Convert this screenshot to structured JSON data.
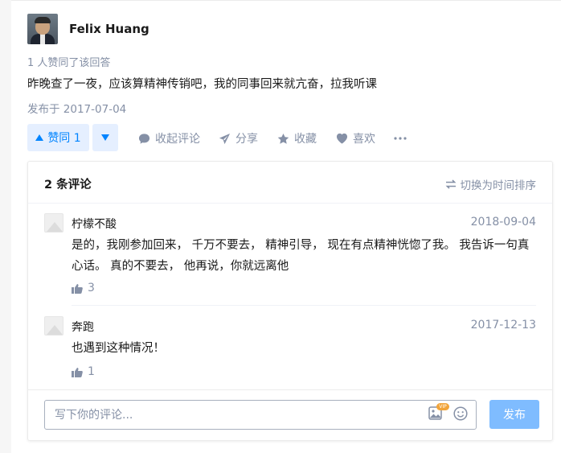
{
  "answer": {
    "author": "Felix Huang",
    "votes_text": "1 人赞同了该回答",
    "content": "昨晚查了一夜，应该算精神传销吧，我的同事回来就亢奋，拉我听课",
    "published": "发布于 2017-07-04"
  },
  "actions": {
    "upvote_label": "赞同 1",
    "collapse_comments": "收起评论",
    "share": "分享",
    "favorite": "收藏",
    "like": "喜欢"
  },
  "comments_panel": {
    "count_label": "2 条评论",
    "switch_sort": "切换为时间排序",
    "items": [
      {
        "author": "柠檬不酸",
        "date": "2018-09-04",
        "text": "是的，我刚参加回来， 千万不要去， 精神引导， 现在有点精神恍惚了我。 我告诉一句真心话。 真的不要去， 他再说，你就远离他",
        "likes": "3"
      },
      {
        "author": "奔跑",
        "date": "2017-12-13",
        "text": "也遇到这种情况！",
        "likes": "1"
      }
    ],
    "input_placeholder": "写下你的评论...",
    "vip_badge": "VIP",
    "submit": "发布"
  },
  "colors": {
    "accent": "#0084ff",
    "accent_light": "#e5efff",
    "muted": "#8590a6",
    "submit_disabled": "#7fbcff"
  },
  "icons": [
    "comment-icon",
    "share-icon",
    "star-icon",
    "heart-icon",
    "more-icon",
    "switch-icon",
    "thumb-up-icon",
    "image-icon",
    "emoji-icon"
  ]
}
